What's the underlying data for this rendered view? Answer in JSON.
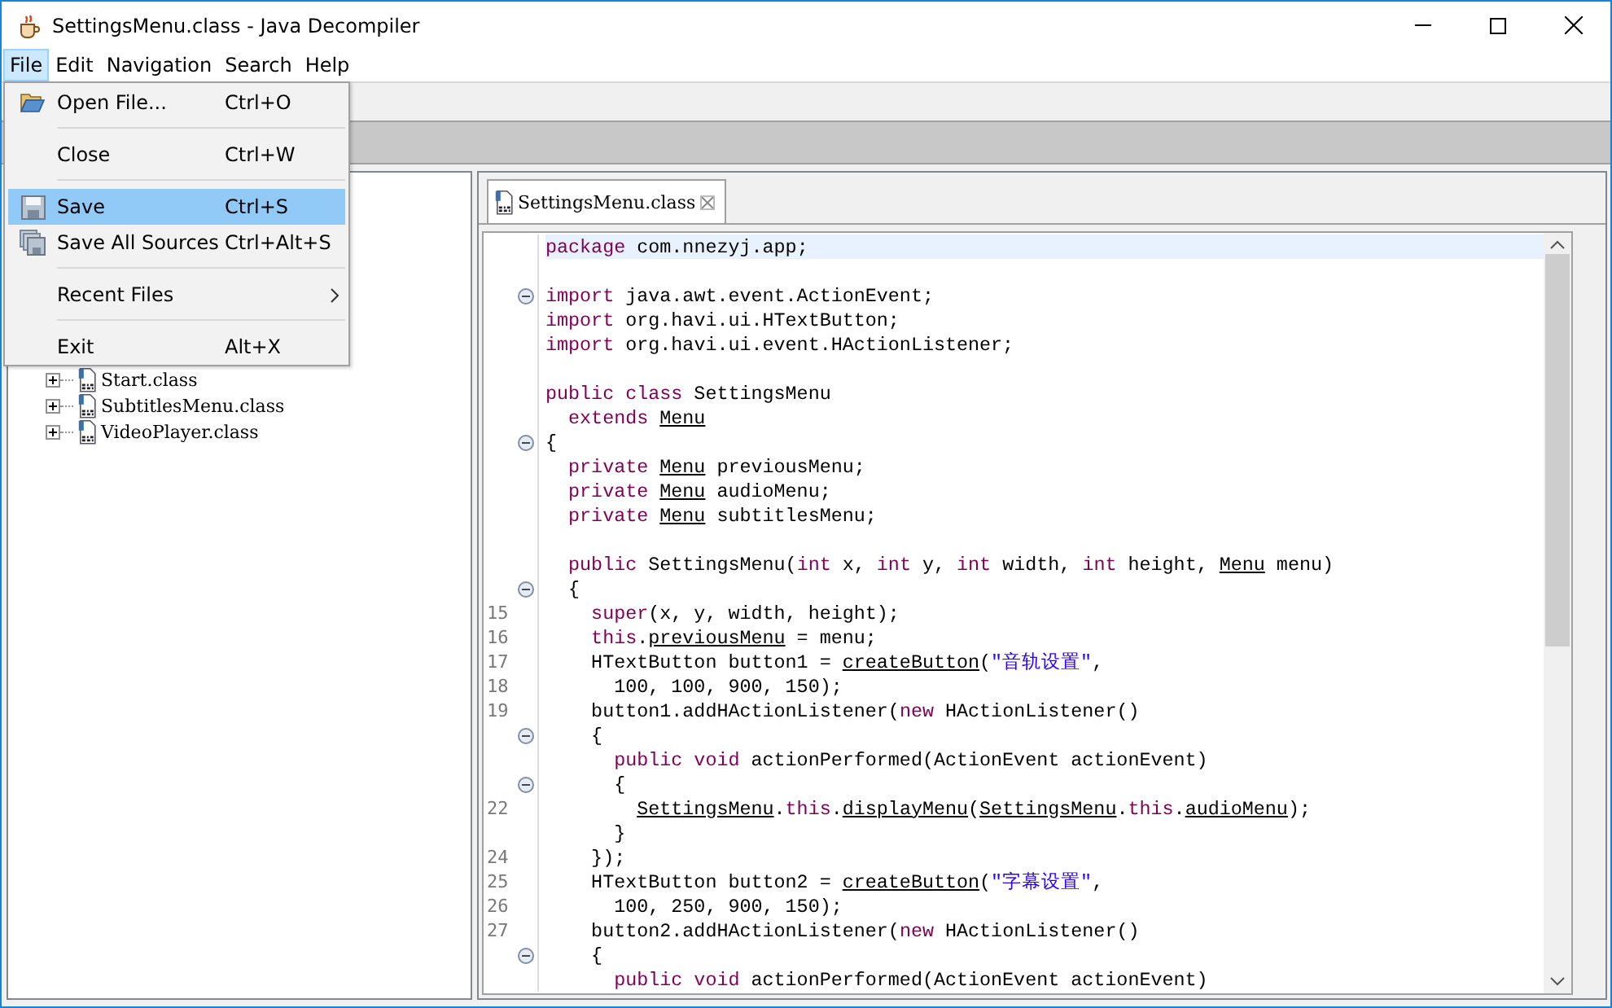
{
  "window": {
    "title": "SettingsMenu.class - Java Decompiler"
  },
  "menu_bar": [
    {
      "label": "File",
      "selected": true
    },
    {
      "label": "Edit",
      "selected": false
    },
    {
      "label": "Navigation",
      "selected": false
    },
    {
      "label": "Search",
      "selected": false
    },
    {
      "label": "Help",
      "selected": false
    }
  ],
  "file_menu": [
    {
      "kind": "item",
      "label": "Open File...",
      "shortcut": "Ctrl+O",
      "selected": false
    },
    {
      "kind": "separator"
    },
    {
      "kind": "item",
      "label": "Close",
      "shortcut": "Ctrl+W",
      "selected": false
    },
    {
      "kind": "separator"
    },
    {
      "kind": "item",
      "label": "Save",
      "shortcut": "Ctrl+S",
      "selected": true
    },
    {
      "kind": "item",
      "label": "Save All Sources",
      "shortcut": "Ctrl+Alt+S",
      "selected": false
    },
    {
      "kind": "separator"
    },
    {
      "kind": "submenu",
      "label": "Recent Files",
      "selected": false
    },
    {
      "kind": "separator"
    },
    {
      "kind": "item",
      "label": "Exit",
      "shortcut": "Alt+X",
      "selected": false
    }
  ],
  "tree": [
    {
      "label": "Start.class",
      "expanded": false
    },
    {
      "label": "SubtitlesMenu.class",
      "expanded": false
    },
    {
      "label": "VideoPlayer.class",
      "expanded": false
    }
  ],
  "editor": {
    "tabs": [
      {
        "label": "SettingsMenu.class",
        "selected": true
      }
    ],
    "lines": [
      {
        "fold": false,
        "current": true,
        "segments": [
          {
            "kind": "keyword",
            "text": "package"
          },
          {
            "kind": "plain",
            "text": " com.nnezyj.app;"
          }
        ]
      },
      {
        "current": false
      },
      {
        "fold": true,
        "current": false,
        "segments": [
          {
            "kind": "keyword",
            "text": "import"
          },
          {
            "kind": "plain",
            "text": " java.awt.event.ActionEvent;"
          }
        ]
      },
      {
        "fold": false,
        "current": false,
        "segments": [
          {
            "kind": "keyword",
            "text": "import"
          },
          {
            "kind": "plain",
            "text": " org.havi.ui.HTextButton;"
          }
        ]
      },
      {
        "fold": false,
        "current": false,
        "segments": [
          {
            "kind": "keyword",
            "text": "import"
          },
          {
            "kind": "plain",
            "text": " org.havi.ui.event.HActionListener;"
          }
        ]
      },
      {
        "current": false
      },
      {
        "fold": false,
        "current": false,
        "segments": [
          {
            "kind": "keyword",
            "text": "public class"
          },
          {
            "kind": "plain",
            "text": " SettingsMenu"
          }
        ]
      },
      {
        "fold": false,
        "current": false,
        "segments": [
          {
            "kind": "keyword",
            "text": "  extends "
          },
          {
            "kind": "link",
            "text": "Menu"
          }
        ]
      },
      {
        "fold": true,
        "current": false,
        "segments": [
          {
            "kind": "plain",
            "text": "{"
          }
        ]
      },
      {
        "fold": false,
        "current": false,
        "segments": [
          {
            "kind": "keyword",
            "text": "  private "
          },
          {
            "kind": "link",
            "text": "Menu"
          },
          {
            "kind": "plain",
            "text": " previousMenu;"
          }
        ]
      },
      {
        "fold": false,
        "current": false,
        "segments": [
          {
            "kind": "keyword",
            "text": "  private "
          },
          {
            "kind": "link",
            "text": "Menu"
          },
          {
            "kind": "plain",
            "text": " audioMenu;"
          }
        ]
      },
      {
        "fold": false,
        "current": false,
        "segments": [
          {
            "kind": "keyword",
            "text": "  private "
          },
          {
            "kind": "link",
            "text": "Menu"
          },
          {
            "kind": "plain",
            "text": " subtitlesMenu;"
          }
        ]
      },
      {
        "current": false
      },
      {
        "fold": false,
        "current": false,
        "segments": [
          {
            "kind": "keyword",
            "text": "  public"
          },
          {
            "kind": "plain",
            "text": " SettingsMenu("
          },
          {
            "kind": "keyword",
            "text": "int"
          },
          {
            "kind": "plain",
            "text": " x, "
          },
          {
            "kind": "keyword",
            "text": "int"
          },
          {
            "kind": "plain",
            "text": " y, "
          },
          {
            "kind": "keyword",
            "text": "int"
          },
          {
            "kind": "plain",
            "text": " width, "
          },
          {
            "kind": "keyword",
            "text": "int"
          },
          {
            "kind": "plain",
            "text": " height, "
          },
          {
            "kind": "link",
            "text": "Menu"
          },
          {
            "kind": "plain",
            "text": " menu)"
          }
        ]
      },
      {
        "fold": true,
        "current": false,
        "segments": [
          {
            "kind": "plain",
            "text": "  {"
          }
        ]
      },
      {
        "number": "15",
        "fold": false,
        "current": false,
        "segments": [
          {
            "kind": "keyword",
            "text": "    super"
          },
          {
            "kind": "plain",
            "text": "(x, y, width, height);"
          }
        ]
      },
      {
        "number": "16",
        "fold": false,
        "current": false,
        "segments": [
          {
            "kind": "keyword",
            "text": "    this"
          },
          {
            "kind": "plain",
            "text": "."
          },
          {
            "kind": "link",
            "text": "previousMenu"
          },
          {
            "kind": "plain",
            "text": " = menu;"
          }
        ]
      },
      {
        "number": "17",
        "fold": false,
        "current": false,
        "segments": [
          {
            "kind": "plain",
            "text": "    HTextButton button1 = "
          },
          {
            "kind": "link",
            "text": "createButton"
          },
          {
            "kind": "plain",
            "text": "("
          },
          {
            "kind": "string",
            "text": "\"音轨设置\""
          },
          {
            "kind": "plain",
            "text": ","
          }
        ]
      },
      {
        "number": "18",
        "fold": false,
        "current": false,
        "segments": [
          {
            "kind": "plain",
            "text": "      100, 100, 900, 150);"
          }
        ]
      },
      {
        "number": "19",
        "fold": false,
        "current": false,
        "segments": [
          {
            "kind": "plain",
            "text": "    button1.addHActionListener("
          },
          {
            "kind": "keyword",
            "text": "new"
          },
          {
            "kind": "plain",
            "text": " HActionListener()"
          }
        ]
      },
      {
        "fold": true,
        "current": false,
        "segments": [
          {
            "kind": "plain",
            "text": "    {"
          }
        ]
      },
      {
        "fold": false,
        "current": false,
        "segments": [
          {
            "kind": "keyword",
            "text": "      public void"
          },
          {
            "kind": "plain",
            "text": " actionPerformed(ActionEvent actionEvent)"
          }
        ]
      },
      {
        "fold": true,
        "current": false,
        "segments": [
          {
            "kind": "plain",
            "text": "      {"
          }
        ]
      },
      {
        "number": "22",
        "fold": false,
        "current": false,
        "segments": [
          {
            "kind": "link",
            "text": "        SettingsMenu"
          },
          {
            "kind": "plain",
            "text": "."
          },
          {
            "kind": "keyword",
            "text": "this"
          },
          {
            "kind": "plain",
            "text": "."
          },
          {
            "kind": "link",
            "text": "displayMenu"
          },
          {
            "kind": "plain",
            "text": "("
          },
          {
            "kind": "link",
            "text": "SettingsMenu"
          },
          {
            "kind": "plain",
            "text": "."
          },
          {
            "kind": "keyword",
            "text": "this"
          },
          {
            "kind": "plain",
            "text": "."
          },
          {
            "kind": "link",
            "text": "audioMenu"
          },
          {
            "kind": "plain",
            "text": ");"
          }
        ]
      },
      {
        "fold": false,
        "current": false,
        "segments": [
          {
            "kind": "plain",
            "text": "      }"
          }
        ]
      },
      {
        "number": "24",
        "fold": false,
        "current": false,
        "segments": [
          {
            "kind": "plain",
            "text": "    });"
          }
        ]
      },
      {
        "number": "25",
        "fold": false,
        "current": false,
        "segments": [
          {
            "kind": "plain",
            "text": "    HTextButton button2 = "
          },
          {
            "kind": "link",
            "text": "createButton"
          },
          {
            "kind": "plain",
            "text": "("
          },
          {
            "kind": "string",
            "text": "\"字幕设置\""
          },
          {
            "kind": "plain",
            "text": ","
          }
        ]
      },
      {
        "number": "26",
        "fold": false,
        "current": false,
        "segments": [
          {
            "kind": "plain",
            "text": "      100, 250, 900, 150);"
          }
        ]
      },
      {
        "number": "27",
        "fold": false,
        "current": false,
        "segments": [
          {
            "kind": "plain",
            "text": "    button2.addHActionListener("
          },
          {
            "kind": "keyword",
            "text": "new"
          },
          {
            "kind": "plain",
            "text": " HActionListener()"
          }
        ]
      },
      {
        "fold": true,
        "current": false,
        "segments": [
          {
            "kind": "plain",
            "text": "    {"
          }
        ]
      },
      {
        "fold": false,
        "current": false,
        "segments": [
          {
            "kind": "keyword",
            "text": "      public void"
          },
          {
            "kind": "plain",
            "text": " actionPerformed(ActionEvent actionEvent)"
          }
        ]
      }
    ]
  }
}
